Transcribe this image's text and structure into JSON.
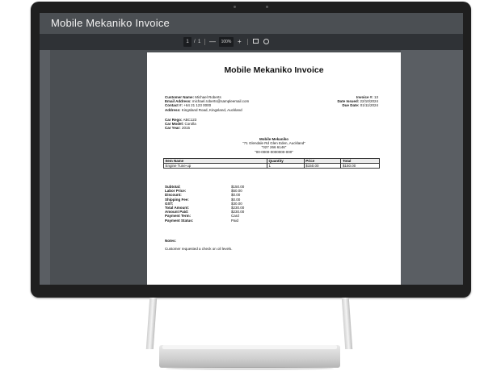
{
  "window": {
    "title": "Mobile Mekaniko Invoice"
  },
  "toolbar": {
    "page_current": "1",
    "page_sep": "/",
    "page_total": "1",
    "zoom_out": "—",
    "zoom": "100%",
    "zoom_in": "+"
  },
  "invoice": {
    "title": "Mobile Mekaniko Invoice",
    "customer": {
      "name_label": "Customer Name:",
      "name": "Michael Roberts",
      "email_label": "Email Address:",
      "email": "michael.roberts@sampleemail.com",
      "contact_label": "Contact #:",
      "contact": "+64 21 123 0000",
      "address_label": "Address:",
      "address": "Kingsland Road, Kingsland, Auckland"
    },
    "meta": {
      "number_label": "Invoice #:",
      "number": "13",
      "issued_label": "Date Issued:",
      "issued": "22/10/2024",
      "due_label": "Due Date:",
      "due": "01/11/2024"
    },
    "vehicle": {
      "rego_label": "Car Rego:",
      "rego": "ABC123",
      "model_label": "Car Model:",
      "model": "Corolla",
      "year_label": "Car Year:",
      "year": "2015"
    },
    "business": {
      "name": "Mobile Mekaniko",
      "address": "\"71 Glendale Rd Glen Eden, Auckland\"",
      "phone": "\"027 266 6146\"",
      "account": "\"00-0000-0000000-000\""
    },
    "table": {
      "headers": [
        "Item Name",
        "Quantity",
        "Price",
        "Total"
      ],
      "rows": [
        [
          "Engine Tune-up",
          "1",
          "$150.00",
          "$150.00"
        ]
      ]
    },
    "totals": [
      {
        "label": "Subtotal:",
        "value": "$150.00"
      },
      {
        "label": "Labor Price:",
        "value": "$50.00"
      },
      {
        "label": "Discount:",
        "value": "$0.00"
      },
      {
        "label": "Shipping Fee:",
        "value": "$0.00"
      },
      {
        "label": "GST:",
        "value": "$30.00"
      },
      {
        "label": "Total Amount:",
        "value": "$230.00"
      },
      {
        "label": "Amount Paid:",
        "value": "$230.00"
      },
      {
        "label": "Payment Term:",
        "value": "Card"
      },
      {
        "label": "Payment Status:",
        "value": "Paid"
      }
    ],
    "notes_label": "Notes:",
    "notes": "Customer requested a check on oil levels."
  }
}
